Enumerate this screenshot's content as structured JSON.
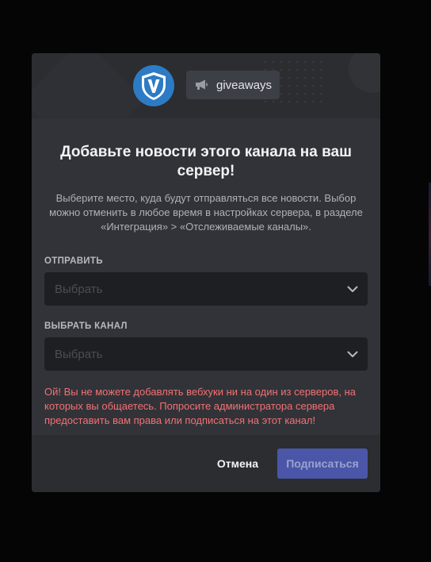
{
  "colors": {
    "backdrop": "#050506",
    "modal_bg": "#313338",
    "header_bg": "#2b2d31",
    "avatar_blue": "#2d7bc4",
    "error_red": "#f27174",
    "button_blurple_disabled": "#4b56a8"
  },
  "header": {
    "server_avatar_icon": "shield-v-logo",
    "channel_icon": "megaphone-icon",
    "channel_name": "giveaways"
  },
  "dialog": {
    "title": "Добавьте новости этого канала на ваш сервер!",
    "description": "Выберите место, куда будут отправляться все новости. Выбор можно отменить в любое время в настройках сервера, в разделе «Интеграция» > «Отслеживаемые каналы».",
    "send_field": {
      "label": "ОТПРАВИТЬ",
      "placeholder": "Выбрать",
      "icon": "chevron-down-icon"
    },
    "channel_field": {
      "label": "ВЫБРАТЬ КАНАЛ",
      "placeholder": "Выбрать",
      "icon": "chevron-down-icon"
    },
    "error_text": "Ой! Вы не можете добавлять вебхуки ни на один из серверов, на которых вы общаетесь. Попросите администратора сервера предоставить вам права или подписаться на этот канал!"
  },
  "footer": {
    "cancel_label": "Отмена",
    "subscribe_label": "Подписаться"
  }
}
